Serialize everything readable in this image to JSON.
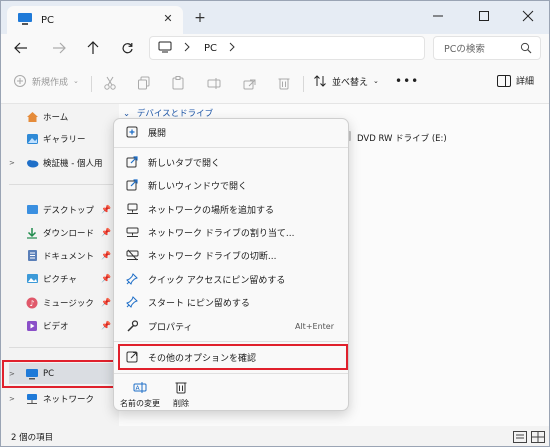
{
  "window": {
    "tab_title": "PC"
  },
  "address": {
    "path": "PC",
    "search_placeholder": "PCの検索"
  },
  "commandbar": {
    "new_label": "新規作成",
    "sort_label": "並べ替え",
    "more_label": "•••",
    "details_label": "詳細"
  },
  "navpane": {
    "items": [
      {
        "label": "ホーム",
        "icon": "home-icon"
      },
      {
        "label": "ギャラリー",
        "icon": "gallery-icon"
      },
      {
        "label": "検証機 - 個人用",
        "icon": "cloud-icon"
      },
      {
        "label": "デスクトップ",
        "icon": "desktop-icon"
      },
      {
        "label": "ダウンロード",
        "icon": "download-icon"
      },
      {
        "label": "ドキュメント",
        "icon": "document-icon"
      },
      {
        "label": "ピクチャ",
        "icon": "pictures-icon"
      },
      {
        "label": "ミュージック",
        "icon": "music-icon"
      },
      {
        "label": "ビデオ",
        "icon": "video-icon"
      },
      {
        "label": "PC",
        "icon": "pc-icon"
      },
      {
        "label": "ネットワーク",
        "icon": "network-icon"
      }
    ]
  },
  "content": {
    "group_header": "デバイスとドライブ",
    "dvd_label": "DVD RW ドライブ (E:)"
  },
  "context_menu": {
    "items": [
      {
        "label": "展開",
        "icon": "expand-icon"
      },
      {
        "label": "新しいタブで開く",
        "icon": "open-tab-icon"
      },
      {
        "label": "新しいウィンドウで開く",
        "icon": "open-window-icon"
      },
      {
        "label": "ネットワークの場所を追加する",
        "icon": "network-location-icon"
      },
      {
        "label": "ネットワーク ドライブの割り当て...",
        "icon": "map-drive-icon"
      },
      {
        "label": "ネットワーク ドライブの切断...",
        "icon": "disconnect-drive-icon"
      },
      {
        "label": "クイック アクセスにピン留めする",
        "icon": "pin-icon"
      },
      {
        "label": "スタート にピン留めする",
        "icon": "pin-start-icon"
      },
      {
        "label": "プロパティ",
        "icon": "properties-icon",
        "shortcut": "Alt+Enter"
      },
      {
        "label": "その他のオプションを確認",
        "icon": "more-options-icon"
      }
    ],
    "bottom_actions": [
      {
        "label": "名前の変更",
        "icon": "rename-icon"
      },
      {
        "label": "削除",
        "icon": "delete-icon"
      }
    ]
  },
  "statusbar": {
    "item_count": "2 個の項目"
  },
  "colors": {
    "accent": "#1d56a8",
    "highlight": "#e0202c"
  }
}
